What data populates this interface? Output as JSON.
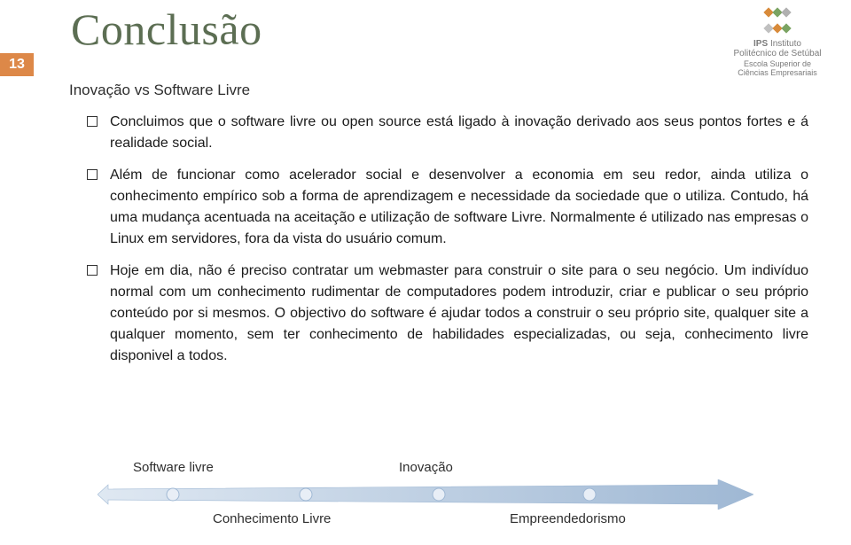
{
  "title": "Conclusão",
  "slide_number": "13",
  "logo": {
    "org_abbr": "IPS",
    "org_line1": "Instituto",
    "org_line2": "Politécnico de Setúbal",
    "school_line1": "Escola Superior de",
    "school_line2": "Ciências Empresariais"
  },
  "subtitle": "Inovação vs Software Livre",
  "bullets": [
    "Concluimos que o software livre ou open source está ligado à inovação derivado aos seus pontos fortes e á realidade social.",
    "Além de funcionar como acelerador social e desenvolver a economia em seu redor, ainda utiliza o conhecimento empírico sob a forma de aprendizagem e necessidade da sociedade que o utiliza. Contudo, há uma mudança acentuada na aceitação e utilização de software Livre. Normalmente é utilizado nas empresas o Linux em servidores, fora da vista do usuário comum.",
    "Hoje em dia, não é preciso contratar um webmaster para construir o site para o seu negócio. Um indivíduo normal com um conhecimento rudimentar de computadores podem introduzir, criar e publicar o seu próprio conteúdo por si mesmos. O objectivo do software é ajudar todos a construir o seu próprio site, qualquer site a qualquer momento, sem ter conhecimento de habilidades especializadas, ou seja, conhecimento livre disponivel a todos."
  ],
  "arrow": {
    "top_left": "Software livre",
    "top_right": "Inovação",
    "bottom_left": "Conhecimento Livre",
    "bottom_right": "Empreendedorismo"
  }
}
